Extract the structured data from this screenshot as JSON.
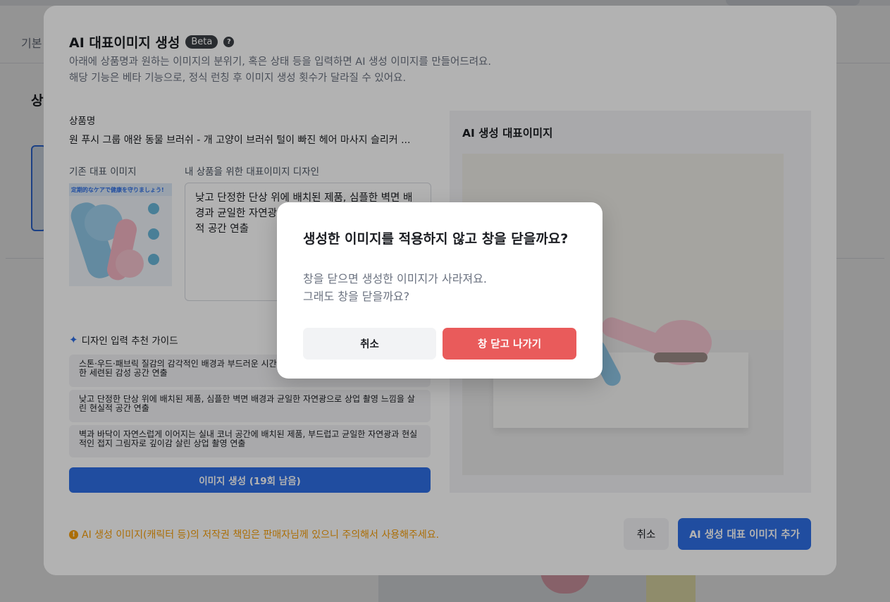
{
  "background": {
    "tab_label": "기본",
    "section_title": "상"
  },
  "modal": {
    "title": "AI 대표이미지 생성",
    "badge": "Beta",
    "help_icon": "question-circle-icon",
    "description_line1": "아래에 상품명과 원하는 이미지의 분위기, 혹은 상태 등을 입력하면 AI 생성 이미지를 만들어드려요.",
    "description_line2": "해당 기능은 베타 기능으로, 정식 런칭 후 이미지 생성 횟수가 달라질 수 있어요.",
    "product_name_label": "상품명",
    "product_name": "원 푸시 그룹 애완 동물 브러쉬 - 개 고양이 브러쉬 털이 빠진 헤어 마사지 슬리커 ...",
    "existing_image_label": "기존 대표 이미지",
    "existing_image_banner": "定期的なケアで健康を守りましょう!",
    "design_label": "내 상품을 위한 대표이미지 디자인",
    "design_text": "낮고 단정한 단상 위에 배치된 제품, 심플한 벽면 배경과 균일한 자연광으로 상업 촬영 느낌을 살린 현실적 공간 연출",
    "guide_title": "디자인 입력 추천 가이드",
    "guide_icon": "sparkle-icon",
    "guide_items": [
      "스톤·우드·패브릭 질감의 감각적인 배경과 부드러운 시간대의 자연광으로 고급스러운 분위기를 더한 세련된 감성 공간 연출",
      "낮고 단정한 단상 위에 배치된 제품, 심플한 벽면 배경과 균일한 자연광으로 상업 촬영 느낌을 살린 현실적 공간 연출",
      "벽과 바닥이 자연스럽게 이어지는 실내 코너 공간에 배치된 제품, 부드럽고 균일한 자연광과 현실적인 접지 그림자로 깊이감 살린 상업 촬영 연출"
    ],
    "generate_button": "이미지 생성 (19회 남음)",
    "result_title": "AI 생성 대표이미지",
    "warning_icon": "exclamation-circle-icon",
    "warning_text": "AI 생성 이미지(캐릭터 등)의 저작권 책임은 판매자님께 있으니 주의해서 사용해주세요.",
    "cancel_button": "취소",
    "add_button": "AI 생성 대표 이미지 추가"
  },
  "confirm": {
    "title": "생성한 이미지를 적용하지 않고 창을 닫을까요?",
    "body_line1": "창을 닫으면 생성한 이미지가 사라져요.",
    "body_line2": "그래도 창을 닫을까요?",
    "cancel_button": "취소",
    "exit_button": "창 닫고 나가기"
  },
  "colors": {
    "accent": "#2f6fe6",
    "danger": "#e95b5b",
    "warning": "#f59e0b"
  }
}
